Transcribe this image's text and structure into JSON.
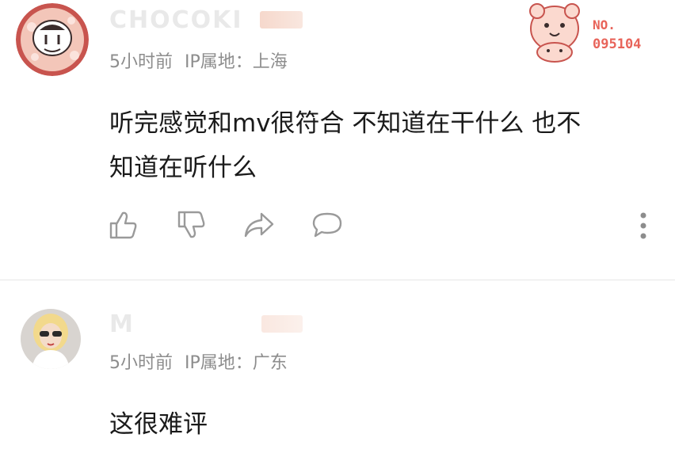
{
  "comments": [
    {
      "username": "CHOCOKI",
      "meta_time": "5小时前",
      "meta_ip": "IP属地：上海",
      "text_line1": "听完感觉和mv很符合 不知道在干什么 也不",
      "text_line2": "知道在听什么",
      "fan_label": "NO.",
      "fan_number": "095104"
    },
    {
      "username": "M",
      "meta_time": "5小时前",
      "meta_ip": "IP属地：广东",
      "text_line1": "这很难评"
    }
  ],
  "icons": [
    "like-icon",
    "dislike-icon",
    "share-icon",
    "reply-icon",
    "more-icon"
  ],
  "colors": {
    "meta": "#8d8d8d",
    "fan_badge": "#e8645a",
    "icon": "#9a9a9a"
  }
}
